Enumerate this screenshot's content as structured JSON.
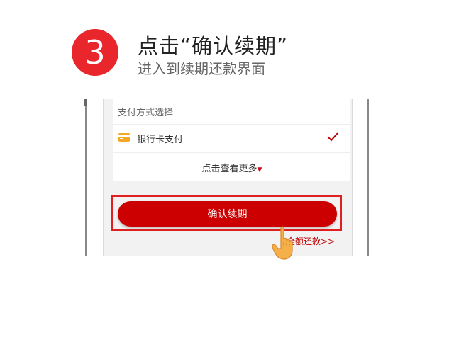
{
  "step": {
    "number": "3",
    "title": "点击“确认续期”",
    "subtitle": "进入到续期还款界面"
  },
  "payment_section": {
    "title": "支付方式选择",
    "method_label": "银行卡支付",
    "more_label": "点击查看更多",
    "more_arrow": "▼"
  },
  "confirm_button": {
    "label": "确认续期"
  },
  "full_repay_link": {
    "label": "全额还款>>"
  },
  "icons": [
    "bank-card-icon",
    "checkmark-icon",
    "dropdown-triangle-icon",
    "pointing-hand-icon"
  ],
  "colors": {
    "step_circle": "#e8262b",
    "primary_button": "#cc0000",
    "highlight": "#e02020",
    "card_icon": "#f5a623",
    "hand": "#f5b04a"
  }
}
